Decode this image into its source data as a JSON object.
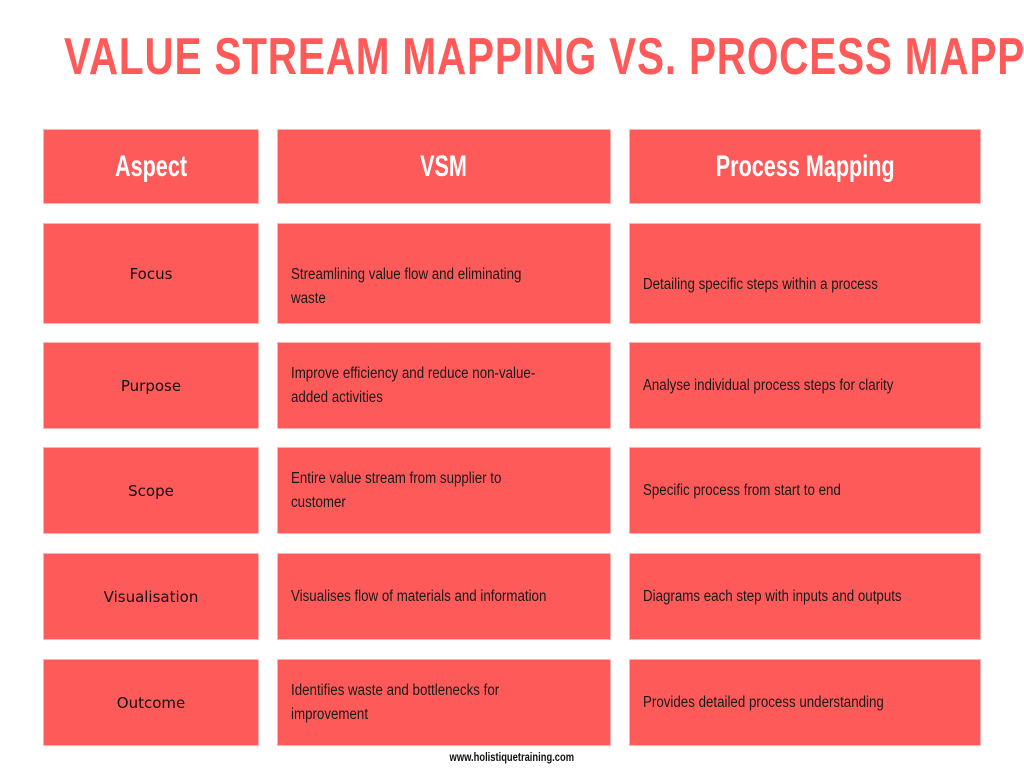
{
  "title": "VALUE STREAM MAPPING VS. PROCESS MAPPING",
  "headers": [
    "Aspect",
    "VSM",
    "Process Mapping"
  ],
  "rows": [
    {
      "aspect": "Focus",
      "vsm": "Streamlining value flow and eliminating waste",
      "process": "Detailing specific steps within a process"
    },
    {
      "aspect": "Purpose",
      "vsm": "Improve efficiency and reduce non-value-added activities",
      "process": "Analyse individual process steps for clarity"
    },
    {
      "aspect": "Scope",
      "vsm": "Entire value stream from supplier to customer",
      "process": "Specific process from start to end"
    },
    {
      "aspect": "Visualisation",
      "vsm": "Visualises flow of materials and information",
      "process": "Diagrams each step with inputs and outputs"
    },
    {
      "aspect": "Outcome",
      "vsm": "Identifies waste and bottlenecks for improvement",
      "process": "Provides detailed process understanding"
    }
  ],
  "footer": "www.holistiquetraining.com",
  "colors": {
    "accent": "#ff5a5a",
    "header_text": "#ffffff",
    "body_text": "#1a1a1a"
  }
}
